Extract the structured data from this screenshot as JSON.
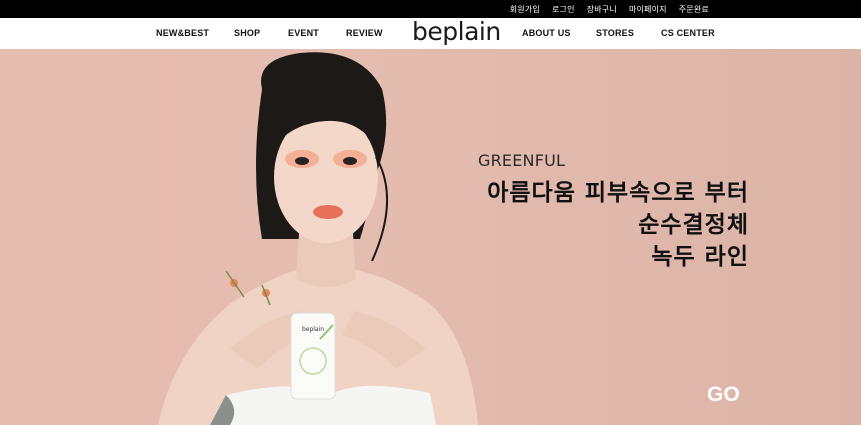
{
  "utility_links": [
    "회원가입",
    "로그인",
    "장바구니",
    "마이페이지",
    "주문완료"
  ],
  "nav": {
    "left": [
      "NEW&BEST",
      "SHOP",
      "EVENT",
      "REVIEW"
    ],
    "logo": "beplain",
    "right": [
      "ABOUT US",
      "STORES",
      "CS CENTER"
    ]
  },
  "hero": {
    "subtitle": "GREENFUL",
    "headline": [
      "아름다움 피부속으로 부터",
      "순수결정체",
      "녹두 라인"
    ],
    "go_label": "GO",
    "product_logo": "beplain"
  },
  "colors": {
    "topbar": "#000000",
    "hero_background": "#e5bcb0",
    "headline": "#111111",
    "go": "#ffffff"
  }
}
